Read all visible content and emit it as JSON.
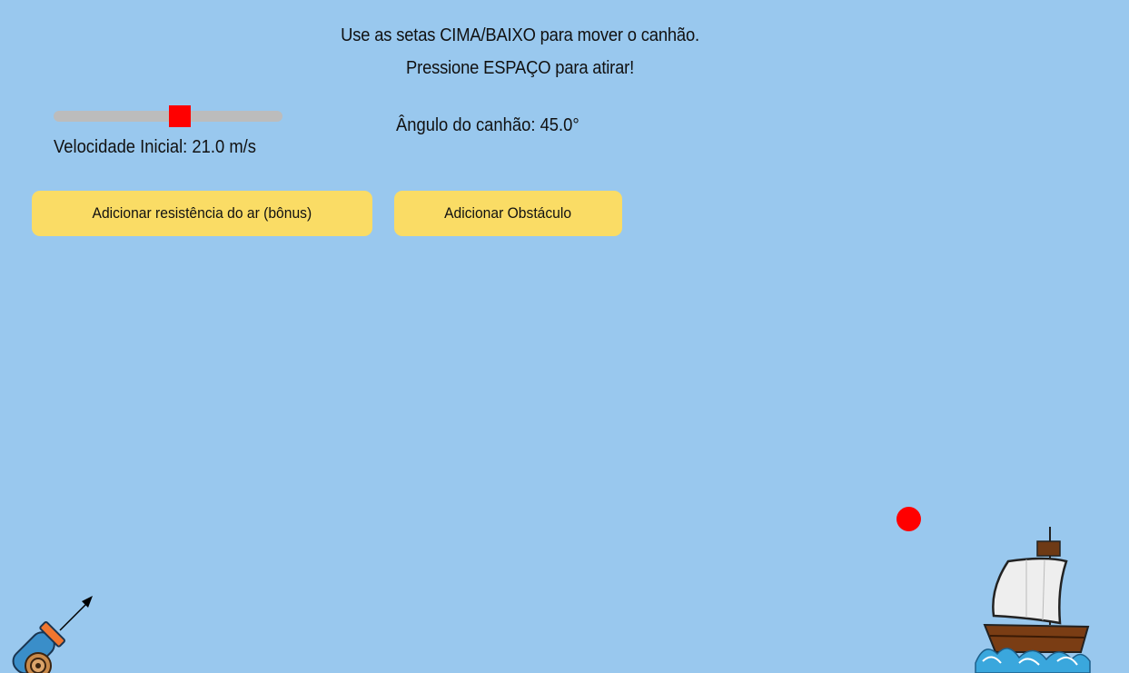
{
  "instructions": {
    "line1": "Use as setas CIMA/BAIXO para mover o canhão.",
    "line2": "Pressione ESPAÇO para atirar!"
  },
  "velocity": {
    "label": "Velocidade Inicial: 21.0 m/s",
    "value": 21.0,
    "unit": "m/s",
    "slider_fraction": 0.55
  },
  "angle": {
    "label": "Ângulo do canhão: 45.0°",
    "value": 45.0
  },
  "buttons": {
    "air_resistance": "Adicionar resistência do ar (bônus)",
    "obstacle": "Adicionar Obstáculo"
  },
  "colors": {
    "background": "#99c8ee",
    "button": "#fadc65",
    "slider_track": "#bcbcbc",
    "slider_thumb": "#ff0000",
    "projectile": "#ff0000"
  },
  "sprites": {
    "cannon": "cannon-icon",
    "aim_arrow": "arrow-icon",
    "target": "pirate-ship-icon",
    "projectile": "cannonball"
  }
}
